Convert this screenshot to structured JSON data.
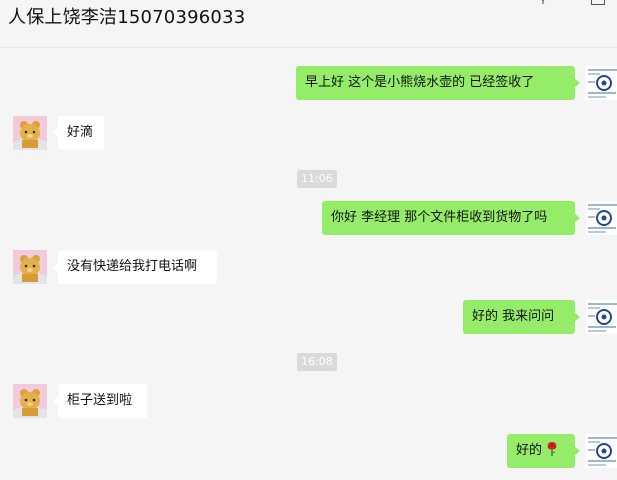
{
  "header": {
    "title": "人保上饶李洁15070396033",
    "pin_icon": "pin-icon"
  },
  "timestamps": [
    "11:06",
    "16:08"
  ],
  "messages": [
    {
      "side": "me",
      "text": "早上好   这个是小熊烧水壶的  已经签收了"
    },
    {
      "side": "them",
      "text": "好滴"
    },
    {
      "side": "me",
      "text": "你好 李经理 那个文件柜收到货物了吗"
    },
    {
      "side": "them",
      "text": "没有快递给我打电话啊"
    },
    {
      "side": "me",
      "text": "好的  我来问问"
    },
    {
      "side": "them",
      "text": "柜子送到啦"
    },
    {
      "side": "me",
      "text": "好的",
      "emoji": "rose-icon"
    }
  ],
  "colors": {
    "sent_bubble": "#95ec69",
    "received_bubble": "#ffffff",
    "background": "#f5f5f5",
    "timestamp_bg": "#dadada"
  }
}
